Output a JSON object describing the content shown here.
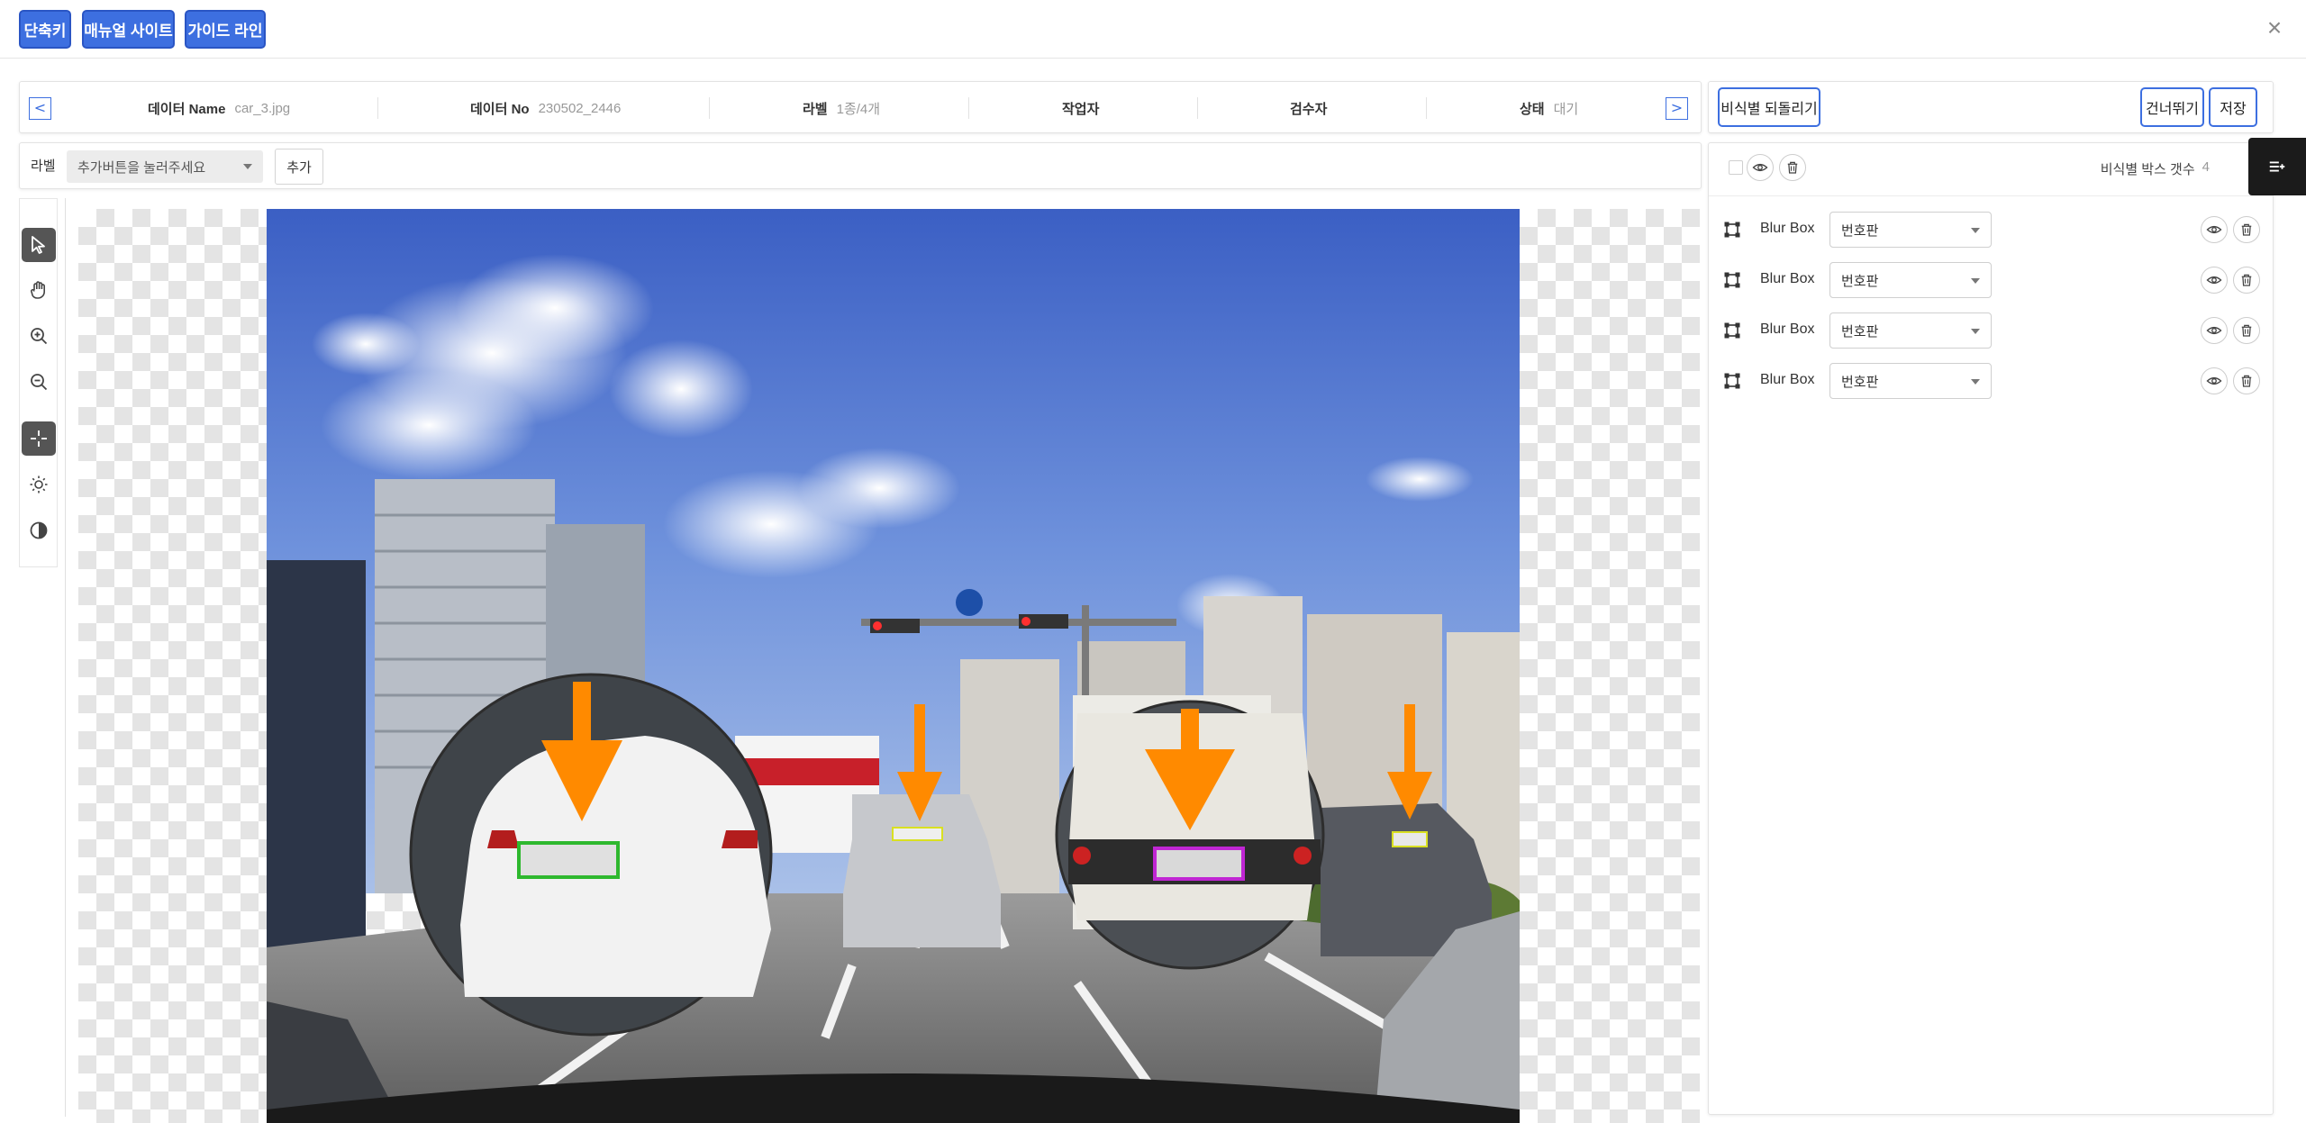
{
  "topbar": {
    "buttons": [
      {
        "label": "단축키"
      },
      {
        "label": "매뉴얼 사이트"
      },
      {
        "label": "가이드 라인"
      }
    ],
    "close_icon": "×"
  },
  "info": {
    "prev_arrow": "<",
    "next_arrow": ">",
    "data_name_key": "데이터 Name",
    "data_name_val": "car_3.jpg",
    "data_no_key": "데이터 No",
    "data_no_val": "230502_2446",
    "label_key": "라벨",
    "label_val": "1종/4개",
    "worker_key": "작업자",
    "reviewer_key": "검수자",
    "status_key": "상태",
    "status_val": "대기"
  },
  "labelbar": {
    "label": "라벨",
    "select_placeholder": "추가버튼을 눌러주세요",
    "add_button": "추가"
  },
  "tools": [
    "select-arrow-icon",
    "hand-pan-icon",
    "zoom-in-icon",
    "zoom-out-icon",
    "crosshair-icon",
    "brightness-icon",
    "contrast-icon"
  ],
  "actions": {
    "revert_button": "비식별 되돌리기",
    "skip_button": "건너뛰기",
    "save_button": "저장"
  },
  "panel": {
    "count_label": "비식별 박스 갯수",
    "count_value": "4",
    "boxes": [
      {
        "name": "Blur Box",
        "type": "번호판"
      },
      {
        "name": "Blur Box",
        "type": "번호판"
      },
      {
        "name": "Blur Box",
        "type": "번호판"
      },
      {
        "name": "Blur Box",
        "type": "번호판"
      }
    ]
  },
  "colors": {
    "accent": "#3d6fe0",
    "annotation_arrow": "#ff8a00",
    "box_green": "#2eb82e",
    "box_magenta": "#c026d3",
    "box_yellow": "#d9e021"
  }
}
